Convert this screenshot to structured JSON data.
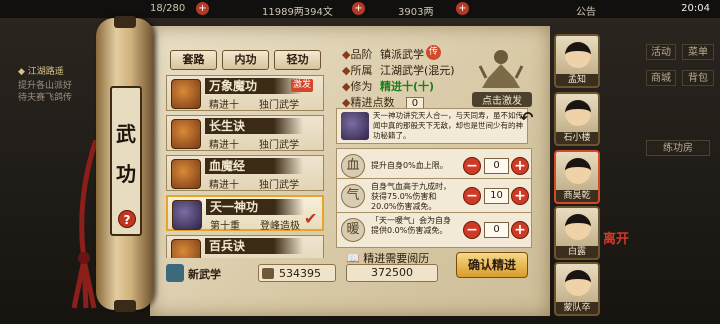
{
  "topbar": {
    "stamina": "18/280",
    "currency_main": "11989两394文",
    "currency_yuanbao": "3903两",
    "notice": "公告",
    "time": "20:04",
    "plus_symbol": "+"
  },
  "background": {
    "quest_title": "江湖路遥",
    "quest_line1": "提升各山派好",
    "quest_line2": "待夫赛飞鸽传"
  },
  "scroll": {
    "title_char_1": "武",
    "title_char_2": "功",
    "help_symbol": "?"
  },
  "tabs": [
    "套路",
    "内功",
    "轻功"
  ],
  "skills": [
    {
      "name": "万象魔功",
      "level": "精进十",
      "type": "独门武学",
      "badge": "激发"
    },
    {
      "name": "长生诀",
      "level": "精进十",
      "type": "独门武学"
    },
    {
      "name": "血魔经",
      "level": "精进十",
      "type": "独门武学"
    },
    {
      "name": "天一神功",
      "level": "第十重",
      "type": "登峰造极"
    },
    {
      "name": "百兵诀"
    }
  ],
  "list_footer": {
    "new_label": "新武学",
    "money_value": "534395"
  },
  "details": {
    "rank_label": "品阶",
    "rank_value": "镇派武学",
    "rank_seal": "传",
    "origin_label": "所属",
    "origin_value": "江湖武学(混元)",
    "cultivation_label": "修为",
    "cultivation_value": "精进十(十)",
    "points_label": "精进点数",
    "points_value": "0",
    "figure_label": "点击激发",
    "bullet": "◆"
  },
  "description": "天一神功讲究天人合一，与天同寿，虽不如传闻中真的那般天下无敌，却也是世间少有的神功秘籍了。",
  "bonuses": [
    {
      "text": "提升自身0%血上限。",
      "value": "0",
      "icon": "血"
    },
    {
      "text": "自身气血高于九成时，获得75.0%伤害和20.0%伤害减免。",
      "value": "10",
      "icon": "气"
    },
    {
      "text": "「天一暖气」会为自身提供0.0%伤害减免。",
      "value": "0",
      "icon": "暖"
    }
  ],
  "controls": {
    "minus": "−",
    "plus": "+"
  },
  "cost": {
    "label": "精进需要阅历",
    "value": "372500"
  },
  "confirm_label": "确认精进",
  "characters": [
    {
      "name": "孟知"
    },
    {
      "name": "石小楼"
    },
    {
      "name": "商昊乾"
    },
    {
      "name": "白露"
    },
    {
      "name": "蒙队卒"
    }
  ],
  "side_buttons": [
    "活动",
    "菜单",
    "商城",
    "背包",
    "练功房"
  ],
  "leave_label": "离开"
}
